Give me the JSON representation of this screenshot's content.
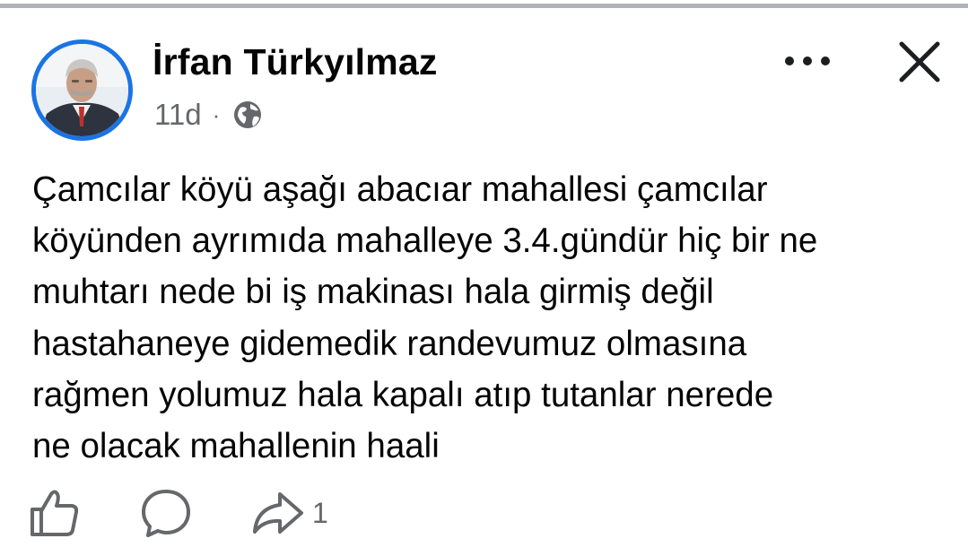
{
  "post": {
    "author": "İrfan Türkyılmaz",
    "time": "11d",
    "separator": "·",
    "audience_icon": "globe-icon",
    "text": "Çamcılar köyü  aşağı abacıar mahallesi  çamcılar\nköyünden ayrımıda mahalleye 3.4.gündür hiç bir ne\nmuhtarı nede bi iş makinası hala girmiş değil\nhastahaneye gidemedik  randevumuz  olmasına\nrağmen yolumuz hala kapalı atıp tutanlar nerede\nne olacak mahallenin haali"
  },
  "header_actions": {
    "more_icon": "more-horizontal-icon",
    "close_icon": "close-icon"
  },
  "actions": {
    "like_icon": "thumbs-up-icon",
    "comment_icon": "comment-icon",
    "share_icon": "share-icon",
    "share_count": "1"
  },
  "colors": {
    "avatar_ring": "#1b74e4",
    "secondary_text": "#65676b",
    "primary_text": "#050505",
    "divider": "#b0b3b8"
  }
}
